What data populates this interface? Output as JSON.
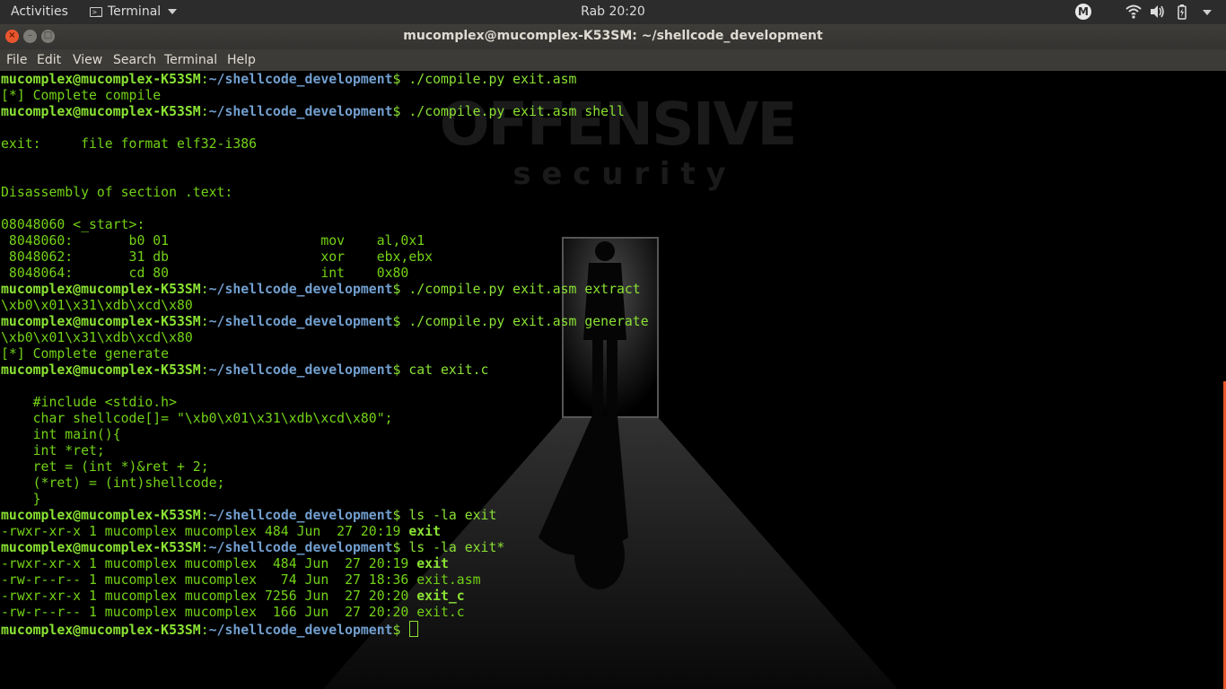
{
  "topbar": {
    "activities": "Activities",
    "app_name": "Terminal",
    "clock": "Rab 20:20",
    "tray_badge": "M",
    "icons": [
      "terminal-icon",
      "wifi-icon",
      "volume-icon",
      "battery-icon",
      "power-caret-icon"
    ]
  },
  "window": {
    "title": "mucomplex@mucomplex-K53SM: ~/shellcode_development",
    "buttons": [
      "close",
      "minimize",
      "maximize"
    ]
  },
  "menu": [
    "File",
    "Edit",
    "View",
    "Search",
    "Terminal",
    "Help"
  ],
  "wallpaper": {
    "logo_top": "OFFENSIVE",
    "logo_bottom": "s e c u r i t y"
  },
  "prompt": {
    "user": "mucomplex@mucomplex-K53SM",
    "sep": ":",
    "path": "~/shellcode_development",
    "sign": "$ "
  },
  "lines": [
    {
      "cmd": "./compile.py exit.asm"
    },
    {
      "out": "[*] Complete compile"
    },
    {
      "cmd": "./compile.py exit.asm shell"
    },
    {
      "out": ""
    },
    {
      "out": "exit:     file format elf32-i386"
    },
    {
      "out": ""
    },
    {
      "out": ""
    },
    {
      "out": "Disassembly of section .text:"
    },
    {
      "out": ""
    },
    {
      "out": "08048060 <_start>:"
    },
    {
      "out": " 8048060:       b0 01                   mov    al,0x1"
    },
    {
      "out": " 8048062:       31 db                   xor    ebx,ebx"
    },
    {
      "out": " 8048064:       cd 80                   int    0x80"
    },
    {
      "cmd": "./compile.py exit.asm extract"
    },
    {
      "out": "\\xb0\\x01\\x31\\xdb\\xcd\\x80"
    },
    {
      "cmd": "./compile.py exit.asm generate"
    },
    {
      "out": "\\xb0\\x01\\x31\\xdb\\xcd\\x80"
    },
    {
      "out": "[*] Complete generate"
    },
    {
      "cmd": "cat exit.c"
    },
    {
      "out": ""
    },
    {
      "out": "    #include <stdio.h>"
    },
    {
      "out": "    char shellcode[]= \"\\xb0\\x01\\x31\\xdb\\xcd\\x80\";"
    },
    {
      "out": "    int main(){"
    },
    {
      "out": "    int *ret;"
    },
    {
      "out": "    ret = (int *)&ret + 2;"
    },
    {
      "out": "    (*ret) = (int)shellcode;"
    },
    {
      "out": "    }"
    },
    {
      "cmd": "ls -la exit"
    },
    {
      "out": "-rwxr-xr-x 1 mucomplex mucomplex 484 Jun  27 20:19 ",
      "exec": "exit"
    },
    {
      "cmd": "ls -la exit*"
    },
    {
      "out": "-rwxr-xr-x 1 mucomplex mucomplex  484 Jun  27 20:19 ",
      "exec": "exit"
    },
    {
      "out": "-rw-r--r-- 1 mucomplex mucomplex   74 Jun  27 18:36 exit.asm"
    },
    {
      "out": "-rwxr-xr-x 1 mucomplex mucomplex 7256 Jun  27 20:20 ",
      "exec": "exit_c"
    },
    {
      "out": "-rw-r--r-- 1 mucomplex mucomplex  166 Jun  27 20:20 exit.c"
    },
    {
      "cmd": "",
      "cursor": true
    }
  ]
}
